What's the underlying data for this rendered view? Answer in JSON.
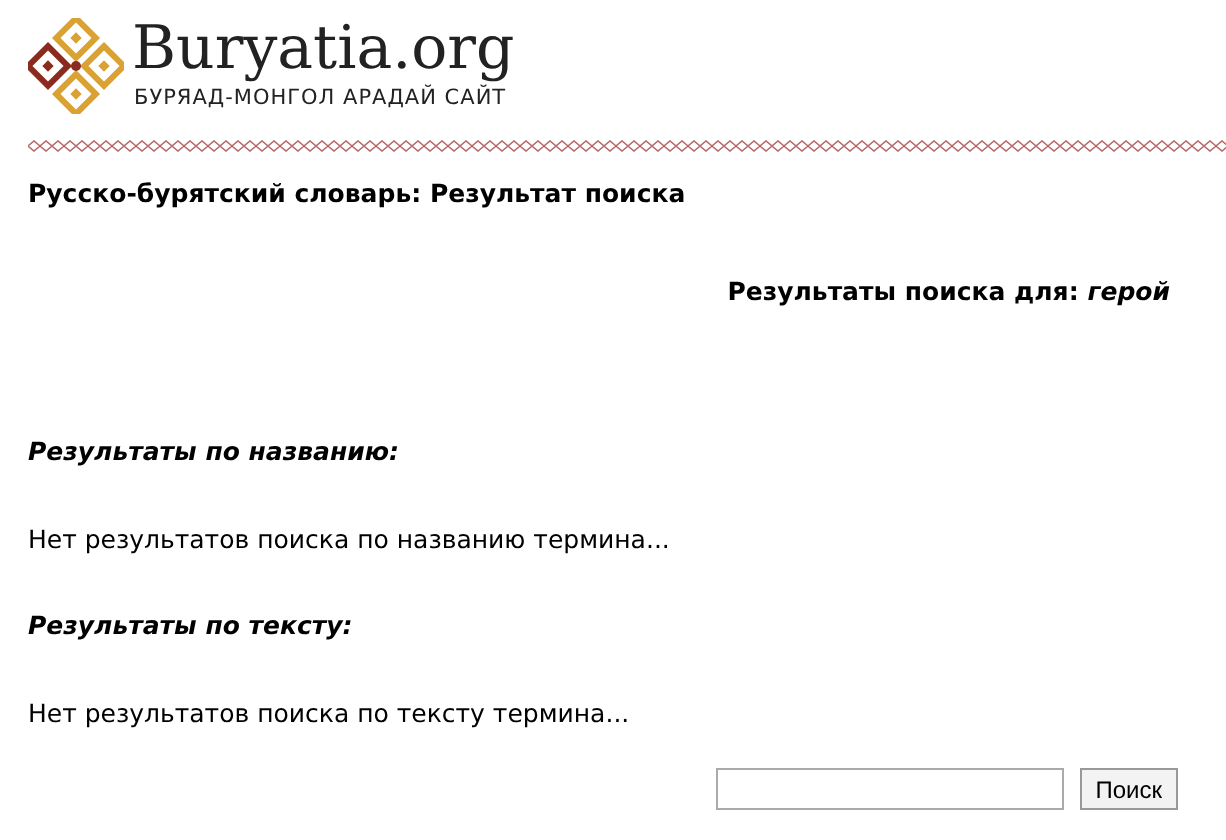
{
  "header": {
    "site_name": "Buryatia.org",
    "tagline": "БУРЯАД-МОНГОЛ АРАДАЙ САЙТ"
  },
  "page_title": "Русско-бурятский словарь: Результат поиска",
  "results_for": "Результаты поиска для: *герой*",
  "sections": [
    {
      "heading": "Результаты по названию:",
      "message": "Нет результатов поиска по названию термина..."
    },
    {
      "heading": "Результаты по тексту:",
      "message": "Нет результатов поиска по тексту термина..."
    }
  ],
  "search": {
    "button": "Поиск"
  }
}
